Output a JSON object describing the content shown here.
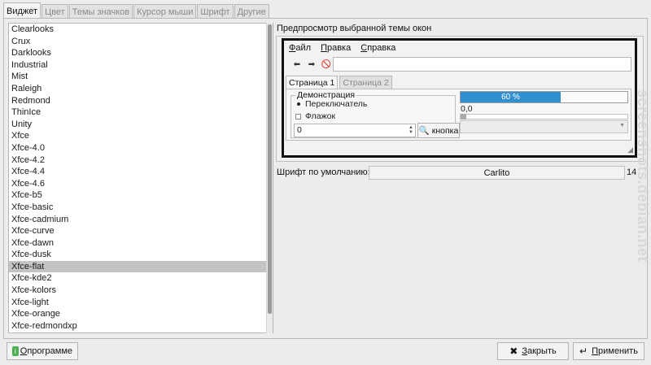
{
  "tabs": [
    "Виджет",
    "Цвет",
    "Темы значков",
    "Курсор мыши",
    "Шрифт",
    "Другие"
  ],
  "active_tab": 0,
  "themes": [
    "Clearlooks",
    "Crux",
    "Darklooks",
    "Industrial",
    "Mist",
    "Raleigh",
    "Redmond",
    "ThinIce",
    "Unity",
    "Xfce",
    "Xfce-4.0",
    "Xfce-4.2",
    "Xfce-4.4",
    "Xfce-4.6",
    "Xfce-b5",
    "Xfce-basic",
    "Xfce-cadmium",
    "Xfce-curve",
    "Xfce-dawn",
    "Xfce-dusk",
    "Xfce-flat",
    "Xfce-kde2",
    "Xfce-kolors",
    "Xfce-light",
    "Xfce-orange",
    "Xfce-redmondxp"
  ],
  "selected_theme": "Xfce-flat",
  "preview": {
    "label": "Предпросмотр выбранной темы окон",
    "menu": [
      "Файл",
      "Правка",
      "Справка"
    ],
    "menu_mnemonic": [
      "Ф",
      "П",
      "С"
    ],
    "menu_rest": [
      "айл",
      "равка",
      "правка"
    ],
    "tabs": [
      "Страница 1",
      "Страница 2"
    ],
    "frame_title": "Демонстрация",
    "radio_label": "Переключатель",
    "check_label": "Флажок",
    "spin_value": "0",
    "button_label": "кнопка",
    "progress_text": "60 %",
    "progress_value": 0.6,
    "scale_value": "0,0"
  },
  "font": {
    "label": "Шрифт по умолчанию:",
    "name": "Carlito",
    "size": "14"
  },
  "buttons": {
    "about": "О программе",
    "about_mnemonic": "О",
    "about_rest": " программе",
    "close": "Закрыть",
    "close_mnemonic": "З",
    "close_rest": "акрыть",
    "apply": "Применить",
    "apply_mnemonic": "П",
    "apply_rest": "рименить"
  },
  "watermark": "screenshots.debian.net",
  "colors": {
    "progress": "#2f8fcf",
    "selection": "#c4c4c4"
  }
}
